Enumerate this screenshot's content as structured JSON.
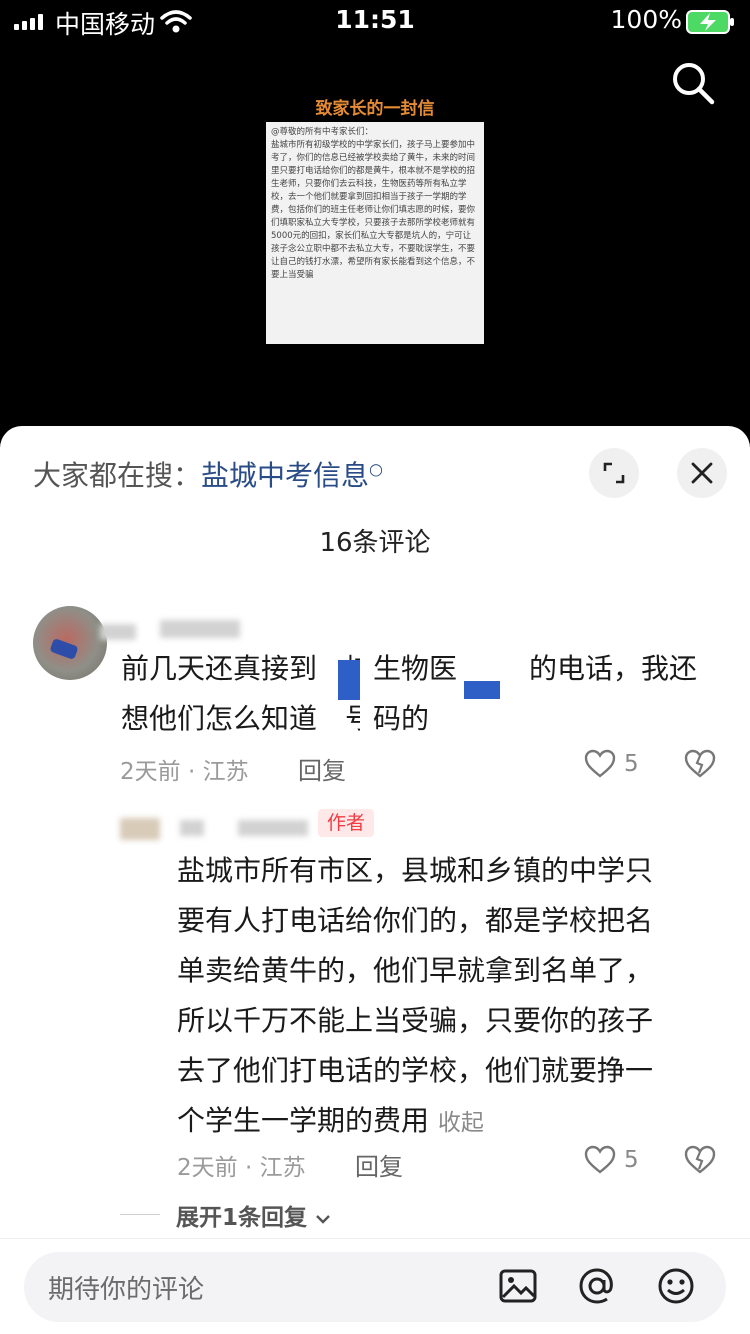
{
  "status_bar": {
    "carrier": "中国移动",
    "time": "11:51",
    "battery": "100%"
  },
  "video": {
    "letter_title": "致家长的一封信",
    "letter_body": "@尊敬的所有中考家长们：\n盐城市所有初级学校的中学家长们，孩子马上要参加中考了，你们的信息已经被学校卖给了黄牛，未来的时间里只要打电话给你们的都是黄牛，根本就不是学校的招生老师，只要你们去云科技，生物医药等所有私立学校，去一个他们就要拿到回扣相当于孩子一学期的学费，包括你们的班主任老师让你们填志愿的时候，要你们填职家私立大专学校，只要孩子去那所学校老师就有5000元的回扣，家长们私立大专都是坑人的，宁可让孩子念公立职中都不去私立大专，不要耽误学生，不要让自己的钱打水漂，希望所有家长能看到这个信息，不要上当受骗"
  },
  "sheet": {
    "hot_search_prefix": "大家都在搜：",
    "hot_search_term": "盐城中考信息",
    "comment_count": "16条评论",
    "comments": [
      {
        "line1_a": "前几天还真接到",
        "line1_b": "城生物医",
        "line1_c": "的电话，我还",
        "line2_a": "想他们怎么知道",
        "line2_b": "号码的",
        "meta": "2天前 · 江苏",
        "reply": "回复",
        "likes": "5"
      },
      {
        "badge": "作者",
        "lines": [
          "盐城市所有市区，县城和乡镇的中学只",
          "要有人打电话给你们的，都是学校把名",
          "单卖给黄牛的，他们早就拿到名单了，",
          "所以千万不能上当受骗，只要你的孩子",
          "去了他们打电话的学校，他们就要挣一",
          "个学生一学期的费用"
        ],
        "collapse": "收起",
        "meta": "2天前 · 江苏",
        "reply": "回复",
        "likes": "5"
      }
    ],
    "expand_replies": "展开1条回复",
    "input_placeholder": "期待你的评论"
  }
}
